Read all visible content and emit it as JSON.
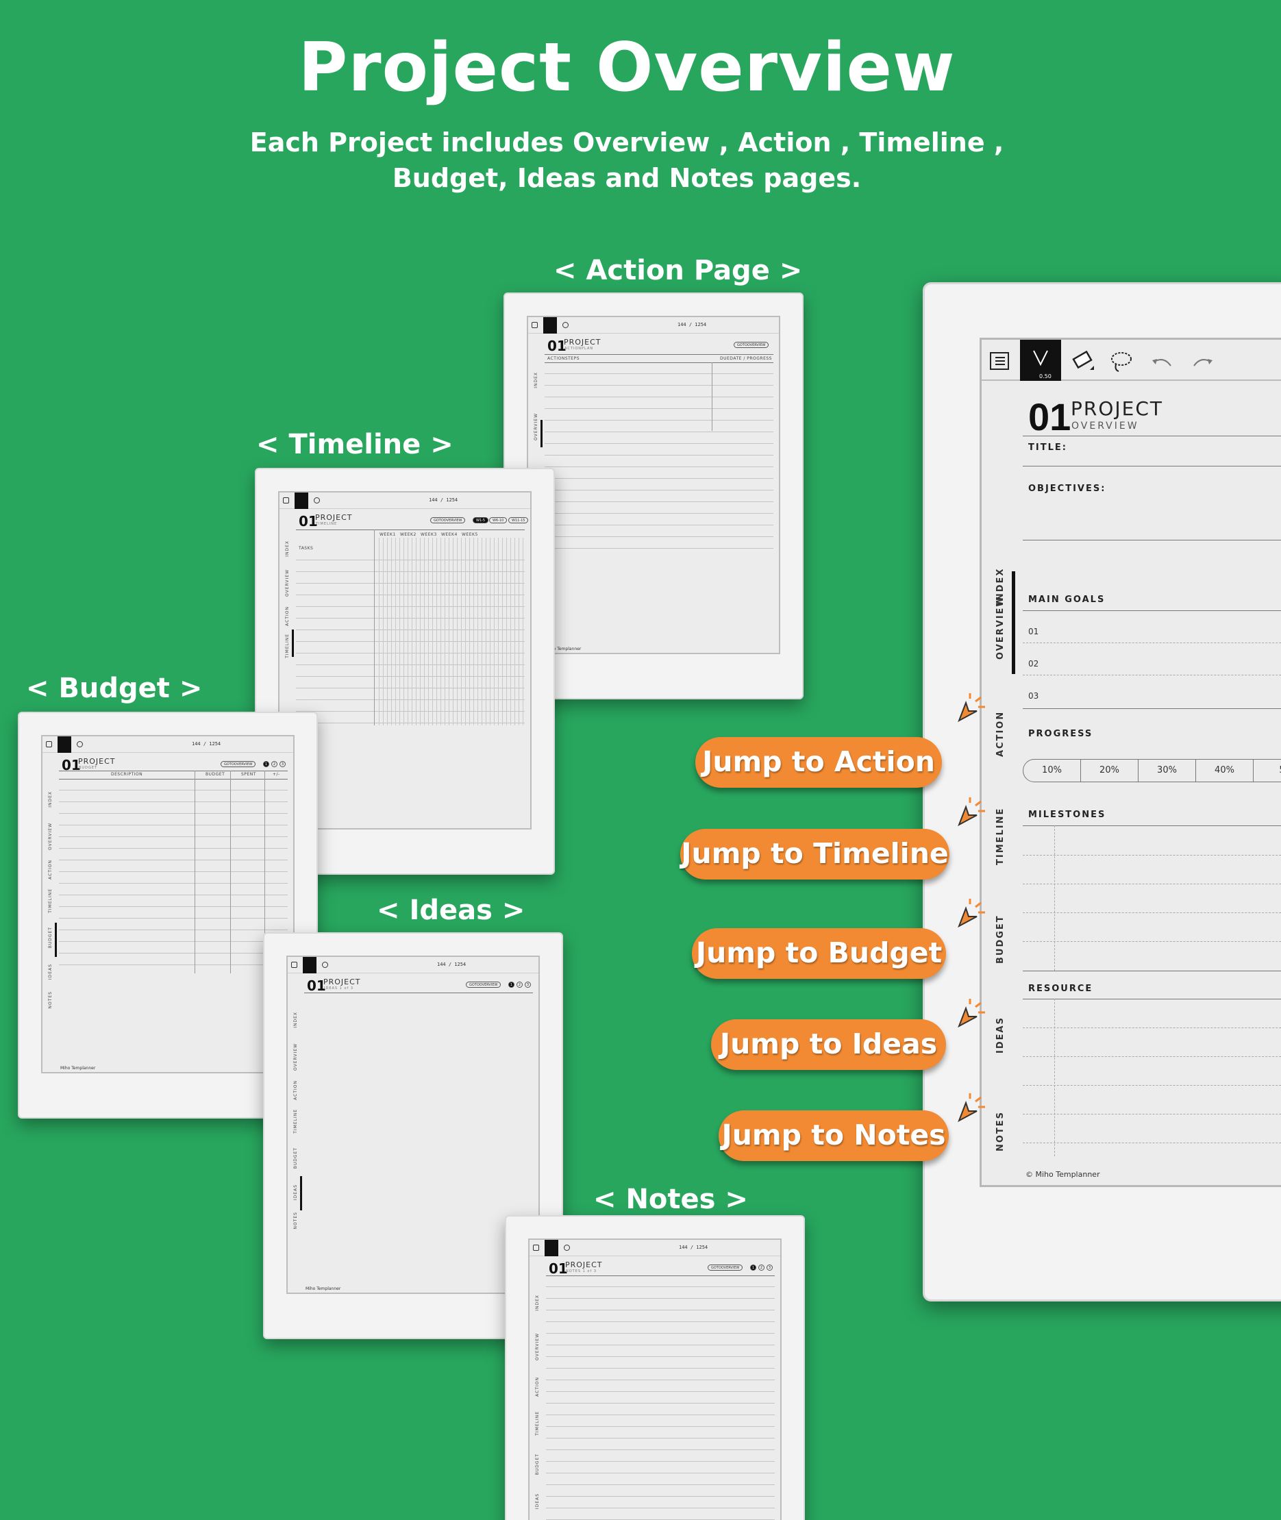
{
  "title": "Project Overview",
  "subtitle_line1": "Each Project includes Overview , Action , Timeline ,",
  "subtitle_line2": "Budget, Ideas and Notes pages.",
  "labels": {
    "action": "< Action Page >",
    "timeline": "< Timeline >",
    "budget": "< Budget >",
    "ideas": "< Ideas >",
    "notes": "< Notes >"
  },
  "jump_buttons": [
    "Jump to Action",
    "Jump to Timeline",
    "Jump to Budget",
    "Jump to Ideas",
    "Jump to Notes"
  ],
  "mini": {
    "page_number": "01",
    "project": "PROJECT",
    "page_indicator": "144 / 1254",
    "goto": "GOTOOVERVIEW",
    "brand": "Miho Templanner",
    "action_sub": "ACTIONPLAN",
    "action_cols": [
      "ACTIONSTEPS",
      "DUEDATE / PROGRESS"
    ],
    "timeline_sub": "TIMELINE",
    "timeline_weeks": [
      "WEEK1",
      "WEEK2",
      "WEEK3",
      "WEEK4",
      "WEEK5"
    ],
    "timeline_tasks": "TASKS",
    "timeline_pills": [
      "W1-5",
      "W6-10",
      "W11-15"
    ],
    "budget_sub": "BUDGET",
    "budget_cols": [
      "DESCRIPTION",
      "BUDGET",
      "SPENT",
      "+/-"
    ],
    "ideas_sub": "IDEAS 1 of 3",
    "notes_sub": "NOTES 1 of 3",
    "dots": [
      "1",
      "2",
      "3"
    ]
  },
  "overview": {
    "page_number": "01",
    "project": "PROJECT",
    "sub": "OVERVIEW",
    "pen_size": "0.50",
    "title_label": "TITLE:",
    "objectives_label": "OBJECTIVES:",
    "main_goals_label": "MAIN GOALS",
    "goals": [
      "01",
      "02",
      "03"
    ],
    "progress_label": "PROGRESS",
    "progress": [
      "10%",
      "20%",
      "30%",
      "40%",
      "5"
    ],
    "milestones_label": "MILESTONES",
    "resource_label": "RESOURCE",
    "brand": "Miho Templanner",
    "side_tabs": [
      "INDEX",
      "OVERVIEW",
      "ACTION",
      "TIMELINE",
      "BUDGET",
      "IDEAS",
      "NOTES"
    ]
  },
  "colors": {
    "background": "#28a65e",
    "button": "#f18a32"
  }
}
